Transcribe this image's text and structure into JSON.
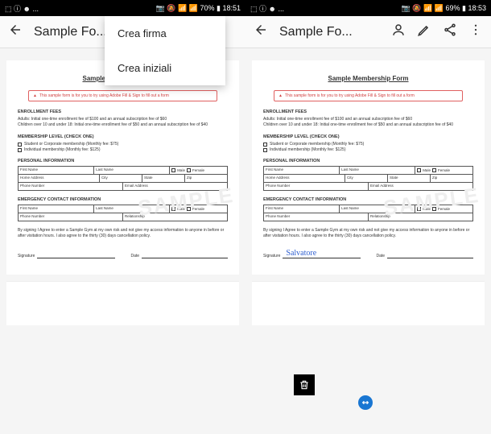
{
  "left": {
    "status": {
      "icons": "⬚ ⓘ ☻ ...",
      "right": "📷 🔕 📶 📶 70% ▮ 18:51"
    },
    "appbar": {
      "title": "Sample Fo..."
    },
    "menu": {
      "item1": "Crea firma",
      "item2": "Crea iniziali"
    }
  },
  "right": {
    "status": {
      "icons": "⬚ ⓘ ☻ ...",
      "right": "📷 🔕 📶 📶 69% ▮ 18:53"
    },
    "appbar": {
      "title": "Sample Fo..."
    },
    "signature_text": "Salvatore"
  },
  "form": {
    "title": "Sample Membership Form",
    "warn": "This sample form is for you to try using Adobe Fill & Sign to fill out a form",
    "enroll_h": "ENROLLMENT FEES",
    "enroll_1": "Adults: Initial one-time enrollment fee of $100 and an annual subscription fee of $60",
    "enroll_2": "Children over 10 and under 18: Initial one-time enrollment fee of $50 and an annual subscription fee of $40",
    "level_h": "MEMBERSHIP LEVEL (CHECK ONE)",
    "level_1": "Student or Corporate membership (Monthly fee: $75)",
    "level_2": "Individual membership (Monthly fee: $125)",
    "personal_h": "PERSONAL INFORMATION",
    "fn": "First Name",
    "ln": "Last Name",
    "male": "Male",
    "female": "Female",
    "home": "Home Address",
    "city": "City",
    "state": "State",
    "zip": "Zip",
    "phone": "Phone Number",
    "email": "Email Address",
    "emerg_h": "EMERGENCY CONTACT INFORMATION",
    "rel": "Relationship",
    "agree": "By signing I Agree to enter a Sample Gym at my own risk and not give my access information to anyone in before or after visitation hours. I also agree to the thirty (30) days cancellation policy.",
    "sig": "Signature",
    "date": "Date",
    "watermark": "SAMPLE"
  }
}
